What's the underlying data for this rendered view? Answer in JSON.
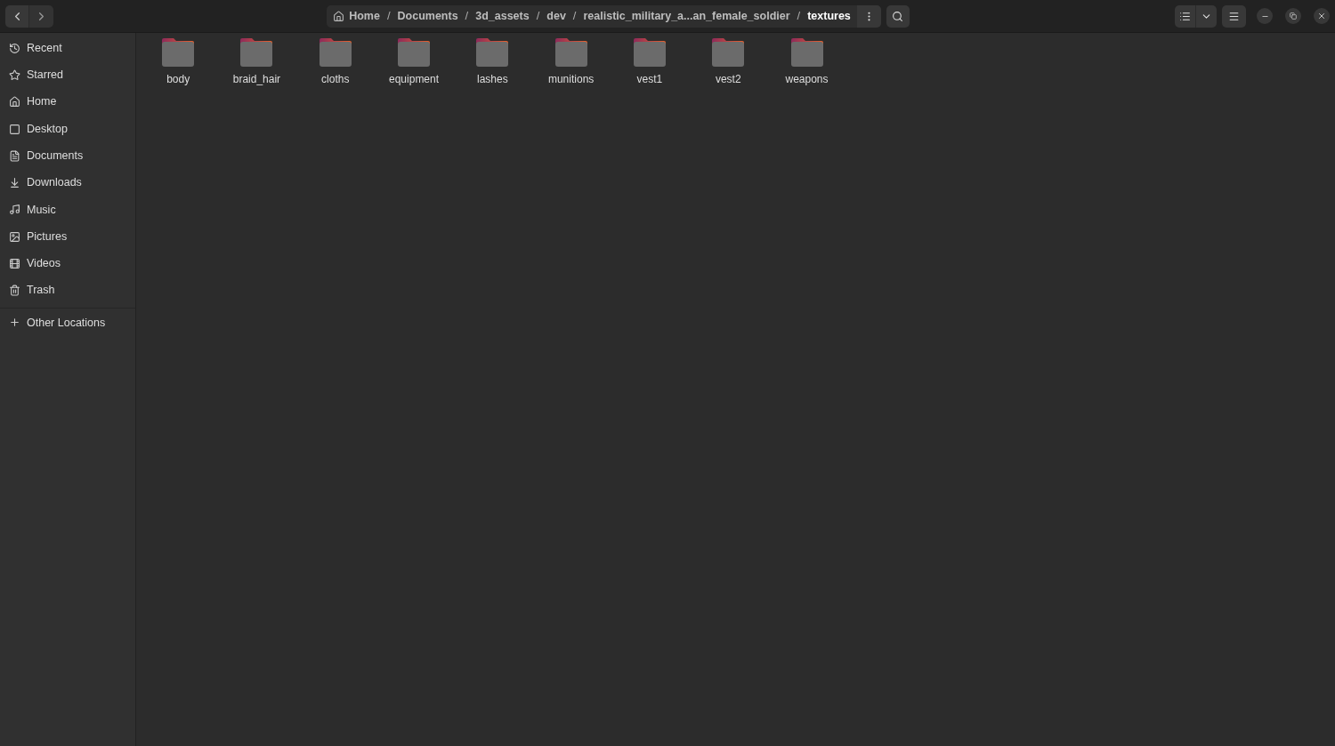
{
  "breadcrumb": [
    {
      "label": "Home",
      "selected": false
    },
    {
      "separator": "/",
      "label": "Documents",
      "selected": false
    },
    {
      "separator": "/",
      "label": "3d_assets",
      "selected": false
    },
    {
      "separator": "/",
      "label": "dev",
      "selected": false
    },
    {
      "separator": "/",
      "label": "realistic_military_a...an_female_soldier",
      "selected": false
    },
    {
      "separator": "/",
      "label": "textures",
      "selected": true
    }
  ],
  "sidebar": {
    "items": [
      {
        "label": "Recent"
      },
      {
        "label": "Starred"
      },
      {
        "label": "Home"
      },
      {
        "label": "Desktop"
      },
      {
        "label": "Documents"
      },
      {
        "label": "Downloads"
      },
      {
        "label": "Music"
      },
      {
        "label": "Pictures"
      },
      {
        "label": "Videos"
      },
      {
        "label": "Trash"
      }
    ],
    "other": {
      "label": "Other Locations"
    }
  },
  "folders": [
    {
      "name": "body"
    },
    {
      "name": "braid_hair"
    },
    {
      "name": "cloths"
    },
    {
      "name": "equipment"
    },
    {
      "name": "lashes"
    },
    {
      "name": "munitions"
    },
    {
      "name": "vest1"
    },
    {
      "name": "vest2"
    },
    {
      "name": "weapons"
    }
  ]
}
